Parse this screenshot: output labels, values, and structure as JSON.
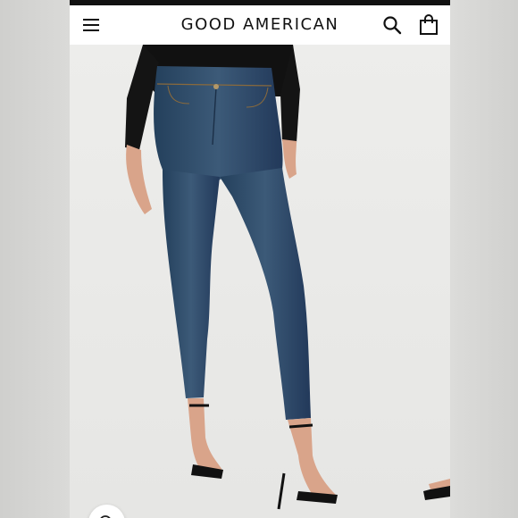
{
  "header": {
    "brand": "GOOD AMERICAN",
    "menu_icon": "hamburger-menu-icon",
    "search_icon": "search-icon",
    "bag_icon": "shopping-bag-icon"
  },
  "product_image": {
    "zoom_icon": "zoom-in-icon"
  },
  "colors": {
    "header_bg": "#ffffff",
    "photo_bg": "#ececea",
    "denim": "#2f4a66",
    "top": "#111111"
  }
}
